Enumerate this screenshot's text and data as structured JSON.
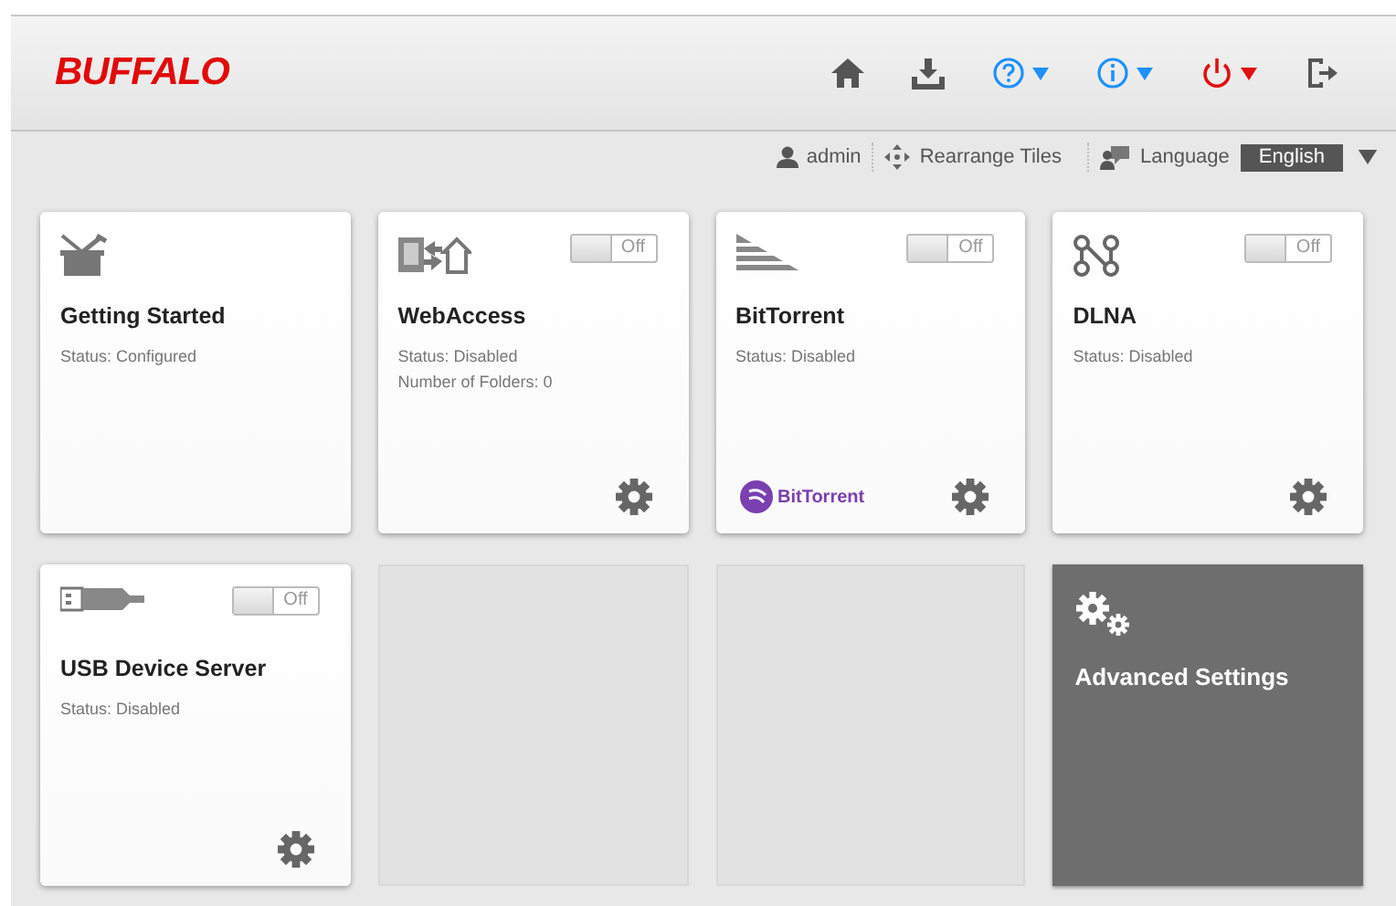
{
  "header": {
    "logo": "BUFFALO",
    "buttons": [
      {
        "kind": "home"
      },
      {
        "kind": "download"
      },
      {
        "kind": "help"
      },
      {
        "kind": "info"
      },
      {
        "kind": "power"
      },
      {
        "kind": "logout"
      }
    ]
  },
  "subbar": {
    "user": "admin",
    "rearrange": "Rearrange Tiles",
    "language_label": "Language",
    "language_value": "English"
  },
  "tiles": [
    {
      "kind": "app",
      "title": "Getting Started",
      "lines": [
        "Status: Configured"
      ],
      "gear": false
    },
    {
      "kind": "app",
      "title": "WebAccess",
      "lines": [
        "Status: Disabled",
        "Number of Folders: 0"
      ],
      "toggle": {
        "on": false,
        "label": "Off"
      },
      "gear": true
    },
    {
      "kind": "app",
      "title": "BitTorrent",
      "lines": [
        "Status: Disabled"
      ],
      "toggle": {
        "on": false,
        "label": "Off"
      },
      "gear": true,
      "brand": "BitTorrent"
    },
    {
      "kind": "app",
      "title": "DLNA",
      "lines": [
        "Status: Disabled"
      ],
      "toggle": {
        "on": false,
        "label": "Off"
      },
      "gear": true
    },
    {
      "kind": "app",
      "title": "USB Device Server",
      "lines": [
        "Status: Disabled"
      ],
      "toggle": {
        "on": false,
        "label": "Off"
      },
      "gear": true
    },
    {
      "kind": "empty"
    },
    {
      "kind": "empty"
    },
    {
      "kind": "advanced",
      "title": "Advanced Settings"
    }
  ]
}
